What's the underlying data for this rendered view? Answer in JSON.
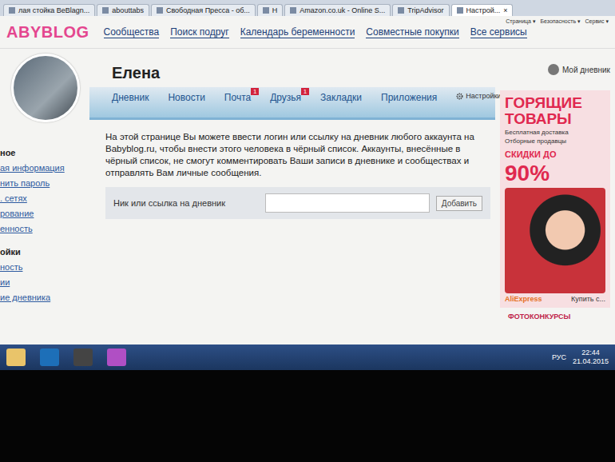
{
  "browser": {
    "tabs": [
      {
        "label": "лая стойка BeBlagn...",
        "selected": false
      },
      {
        "label": "abouttabs",
        "selected": false
      },
      {
        "label": "Свободная Пресса - об...",
        "selected": false
      },
      {
        "label": "H",
        "selected": false
      },
      {
        "label": "Amazon.co.uk - Online S...",
        "selected": false
      },
      {
        "label": "TripAdvisor",
        "selected": false
      },
      {
        "label": "Настрой...",
        "selected": true
      }
    ],
    "close": "×",
    "menus": [
      "Страница ▾",
      "Безопасность ▾",
      "Сервис ▾"
    ]
  },
  "site": {
    "logo": "ABYBLOG",
    "nav": [
      "Сообщества",
      "Поиск подруг",
      "Календарь беременности",
      "Совместные покупки",
      "Все сервисы"
    ]
  },
  "profile": {
    "name": "Елена",
    "my_diary": "Мой дневник",
    "settings": "Настройки дневника"
  },
  "tabs": [
    {
      "label": "Дневник",
      "badge": "",
      "selected": false
    },
    {
      "label": "Новости",
      "badge": "",
      "selected": false
    },
    {
      "label": "Почта",
      "badge": "1",
      "selected": false
    },
    {
      "label": "Друзья",
      "badge": "1",
      "selected": false
    },
    {
      "label": "Закладки",
      "badge": "",
      "selected": false
    },
    {
      "label": "Приложения",
      "badge": "",
      "selected": false
    }
  ],
  "sidebar": {
    "items": [
      {
        "label": "ное",
        "kind": "heading"
      },
      {
        "label": "ая информация",
        "kind": "link"
      },
      {
        "label": "нить пароль",
        "kind": "link"
      },
      {
        "label": ". сетях",
        "kind": "link"
      },
      {
        "label": "рование",
        "kind": "link"
      },
      {
        "label": "енность",
        "kind": "link"
      },
      {
        "label": "ойки",
        "kind": "heading"
      },
      {
        "label": "ность",
        "kind": "link"
      },
      {
        "label": "ии",
        "kind": "link"
      },
      {
        "label": "ие дневника",
        "kind": "link"
      }
    ]
  },
  "content": {
    "text": "На этой странице Вы можете ввести логин или ссылку на дневник любого аккаунта на Babyblog.ru, чтобы внести этого человека в чёрный список. Аккаунты, внесённые в чёрный список, не смогут комментировать Ваши записи в дневнике и сообществах и отправлять Вам личные сообщения.",
    "field_label": "Ник или ссылка на дневник",
    "field_value": "",
    "button": "Добавить"
  },
  "ad": {
    "title": "ГОРЯЩИЕ ТОВАРЫ",
    "bullets": [
      "Бесплатная доставка",
      "Отборные продавцы"
    ],
    "discount_label": "СКИДКИ ДО",
    "discount": "90%",
    "brand": "AliExpress",
    "cta": "Купить с..."
  },
  "below_ad": "ФОТОКОНКУРСЫ",
  "taskbar": {
    "language": "РУС",
    "time": "22:44",
    "date": "21.04.2015"
  }
}
